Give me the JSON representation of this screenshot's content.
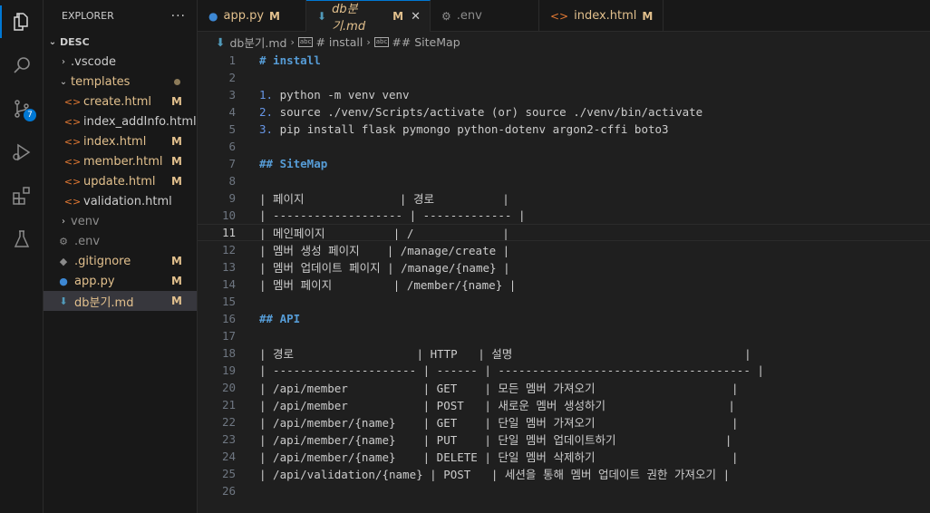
{
  "activity": {
    "scm_badge": "7"
  },
  "sidebar": {
    "title": "EXPLORER",
    "more": "···",
    "root": "DESC",
    "items": [
      {
        "label": ".vscode",
        "stat": ""
      },
      {
        "label": "templates",
        "stat": ""
      },
      {
        "label": "create.html",
        "stat": "M"
      },
      {
        "label": "index_addInfo.html",
        "stat": ""
      },
      {
        "label": "index.html",
        "stat": "M"
      },
      {
        "label": "member.html",
        "stat": "M"
      },
      {
        "label": "update.html",
        "stat": "M"
      },
      {
        "label": "validation.html",
        "stat": ""
      },
      {
        "label": "venv",
        "stat": ""
      },
      {
        "label": ".env",
        "stat": ""
      },
      {
        "label": ".gitignore",
        "stat": "M"
      },
      {
        "label": "app.py",
        "stat": "M"
      },
      {
        "label": "db분기.md",
        "stat": "M"
      }
    ]
  },
  "tabs": [
    {
      "label": "app.py",
      "stat": "M"
    },
    {
      "label": "db분기.md",
      "stat": "M"
    },
    {
      "label": ".env",
      "stat": ""
    },
    {
      "label": "index.html",
      "stat": "M"
    }
  ],
  "breadcrumb": {
    "file": "db분기.md",
    "h1": "# install",
    "h2": "## SiteMap"
  },
  "editor": {
    "lines": [
      "# install",
      "",
      "1. python -m venv venv",
      "2. source ./venv/Scripts/activate (or) source ./venv/bin/activate",
      "3. pip install flask pymongo python-dotenv argon2-cffi boto3",
      "",
      "## SiteMap",
      "",
      "| 페이지              | 경로          |",
      "| ------------------- | ------------- |",
      "| 메인페이지          | /             |",
      "| 멤버 생성 페이지    | /manage/create |",
      "| 멤버 업데이트 페이지 | /manage/{name} |",
      "| 멤버 페이지         | /member/{name} |",
      "",
      "## API",
      "",
      "| 경로                  | HTTP   | 설명                                  |",
      "| --------------------- | ------ | ------------------------------------- |",
      "| /api/member           | GET    | 모든 멤버 가져오기                    |",
      "| /api/member           | POST   | 새로운 멤버 생성하기                  |",
      "| /api/member/{name}    | GET    | 단일 멤버 가져오기                    |",
      "| /api/member/{name}    | PUT    | 단일 멤버 업데이트하기                |",
      "| /api/member/{name}    | DELETE | 단일 멤버 삭제하기                    |",
      "| /api/validation/{name} | POST   | 세션을 통해 멤버 업데이트 권한 가져오기 |",
      ""
    ]
  }
}
